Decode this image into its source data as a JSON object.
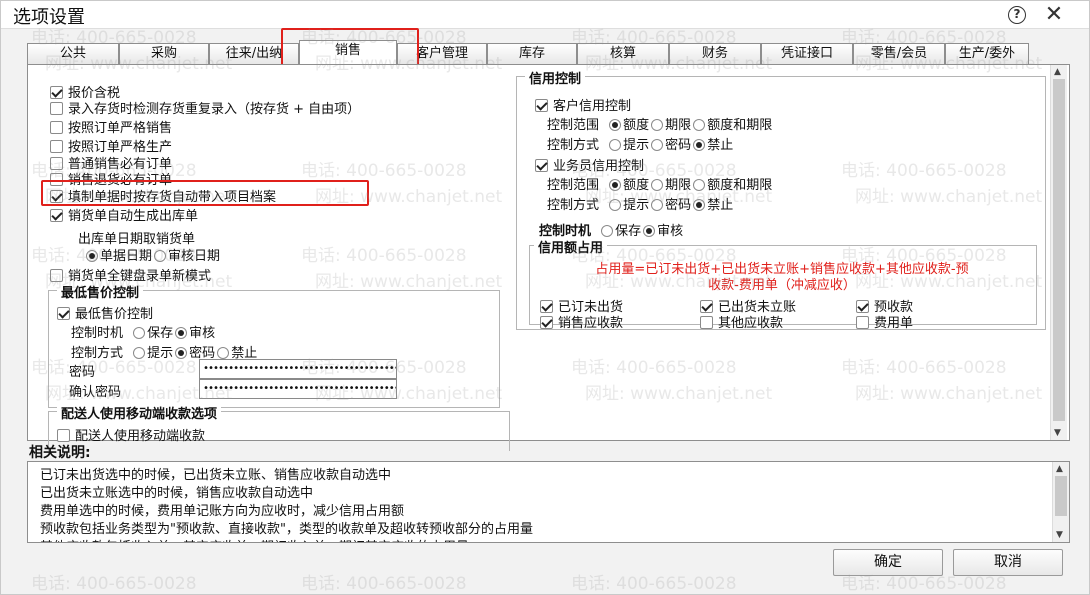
{
  "window": {
    "title": "选项设置"
  },
  "tabs": [
    "公共",
    "采购",
    "往来/出纳",
    "销售",
    "客户管理",
    "库存",
    "核算",
    "财务",
    "凭证接口",
    "零售/会员",
    "生产/委外"
  ],
  "active_tab": "销售",
  "left": {
    "options": [
      {
        "label": "报价含税",
        "checked": true
      },
      {
        "label": "录入存货时检测存货重复录入（按存货 + 自由项）",
        "checked": false
      },
      {
        "label": "按照订单严格销售",
        "checked": false
      },
      {
        "label": "按照订单严格生产",
        "checked": false
      },
      {
        "label": "普通销售必有订单",
        "checked": false
      },
      {
        "label": "销售退货必有订单",
        "checked": false
      },
      {
        "label": "填制单据时按存货自动带入项目档案",
        "checked": true
      },
      {
        "label": "销货单自动生成出库单",
        "checked": true
      }
    ],
    "outbound_date_label": "出库单日期取销货单",
    "date_options": [
      {
        "label": "单据日期",
        "selected": true
      },
      {
        "label": "审核日期",
        "selected": false
      }
    ],
    "keyboard_mode": {
      "label": "销货单全键盘录单新模式",
      "checked": false
    },
    "min_price": {
      "title": "最低售价控制",
      "enable": {
        "label": "最低售价控制",
        "checked": true
      },
      "timing_label": "控制时机",
      "timing_options": [
        {
          "label": "保存",
          "selected": false
        },
        {
          "label": "审核",
          "selected": true
        }
      ],
      "method_label": "控制方式",
      "method_options": [
        {
          "label": "提示",
          "selected": false
        },
        {
          "label": "密码",
          "selected": true
        },
        {
          "label": "禁止",
          "selected": false
        }
      ],
      "password_label": "密码",
      "password_value": "••••••••••••••••••••••••••••••••••••••••••",
      "confirm_label": "确认密码",
      "confirm_value": "••••••••••••••••••••••••••••••••••••••••••"
    },
    "delivery": {
      "title": "配送人使用移动端收款选项",
      "option": {
        "label": "配送人使用移动端收款",
        "checked": false
      }
    }
  },
  "credit": {
    "title": "信用控制",
    "customer": {
      "label": "客户信用控制",
      "checked": true
    },
    "range_label": "控制范围",
    "range_options": [
      {
        "label": "额度",
        "selected": true
      },
      {
        "label": "期限",
        "selected": false
      },
      {
        "label": "额度和期限",
        "selected": false
      }
    ],
    "method_label": "控制方式",
    "method_options": [
      {
        "label": "提示",
        "selected": false
      },
      {
        "label": "密码",
        "selected": false
      },
      {
        "label": "禁止",
        "selected": true
      }
    ],
    "salesman": {
      "label": "业务员信用控制",
      "checked": true
    },
    "range2_label": "控制范围",
    "range2_options": [
      {
        "label": "额度",
        "selected": true
      },
      {
        "label": "期限",
        "selected": false
      },
      {
        "label": "额度和期限",
        "selected": false
      }
    ],
    "method2_label": "控制方式",
    "method2_options": [
      {
        "label": "提示",
        "selected": false
      },
      {
        "label": "密码",
        "selected": false
      },
      {
        "label": "禁止",
        "selected": true
      }
    ],
    "timing_label": "控制时机",
    "timing_options": [
      {
        "label": "保存",
        "selected": false
      },
      {
        "label": "审核",
        "selected": true
      }
    ],
    "usage": {
      "title": "信用额占用",
      "formula_line1": "占用量=已订未出货+已出货未立账+销售应收款+其他应收款-预",
      "formula_line2": "收款-费用单（冲减应收）",
      "items": [
        {
          "label": "已订未出货",
          "checked": true
        },
        {
          "label": "已出货未立账",
          "checked": true
        },
        {
          "label": "预收款",
          "checked": true
        },
        {
          "label": "销售应收款",
          "checked": true
        },
        {
          "label": "其他应收款",
          "checked": false
        },
        {
          "label": "费用单",
          "checked": false
        }
      ]
    }
  },
  "description": {
    "label": "相关说明:",
    "lines": [
      "已订未出货选中的时候，已出货未立账、销售应收款自动选中",
      "已出货未立账选中的时候，销售应收款自动选中",
      "费用单选中的时候，费用单记账方向为应收时，减少信用占用额",
      "预收款包括业务类型为\"预收款、直接收款\"，类型的收款单及超收转预收部分的占用量",
      "其他应收款包括收入单、其它应收单、期初收入单、期初其它应收的占用量"
    ]
  },
  "buttons": {
    "ok": "确定",
    "cancel": "取消"
  },
  "watermark": {
    "phone": "电话: 400-665-0028",
    "site": "网址: www.chanjet.net"
  },
  "colors": {
    "highlight": "#e0201b",
    "formula": "#e0201b"
  }
}
